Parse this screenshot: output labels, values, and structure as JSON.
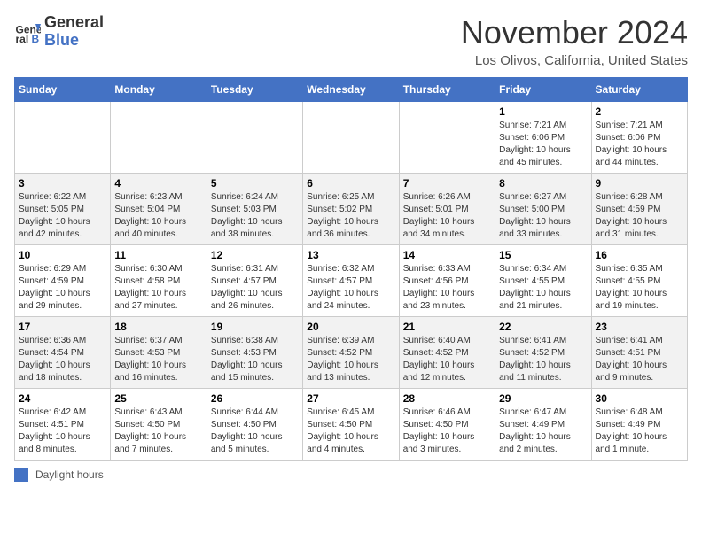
{
  "header": {
    "logo_line1": "General",
    "logo_line2": "Blue",
    "month": "November 2024",
    "location": "Los Olivos, California, United States"
  },
  "days_of_week": [
    "Sunday",
    "Monday",
    "Tuesday",
    "Wednesday",
    "Thursday",
    "Friday",
    "Saturday"
  ],
  "weeks": [
    [
      {
        "day": "",
        "info": ""
      },
      {
        "day": "",
        "info": ""
      },
      {
        "day": "",
        "info": ""
      },
      {
        "day": "",
        "info": ""
      },
      {
        "day": "",
        "info": ""
      },
      {
        "day": "1",
        "info": "Sunrise: 7:21 AM\nSunset: 6:06 PM\nDaylight: 10 hours and 45 minutes."
      },
      {
        "day": "2",
        "info": "Sunrise: 7:21 AM\nSunset: 6:06 PM\nDaylight: 10 hours and 44 minutes."
      }
    ],
    [
      {
        "day": "3",
        "info": "Sunrise: 6:22 AM\nSunset: 5:05 PM\nDaylight: 10 hours and 42 minutes."
      },
      {
        "day": "4",
        "info": "Sunrise: 6:23 AM\nSunset: 5:04 PM\nDaylight: 10 hours and 40 minutes."
      },
      {
        "day": "5",
        "info": "Sunrise: 6:24 AM\nSunset: 5:03 PM\nDaylight: 10 hours and 38 minutes."
      },
      {
        "day": "6",
        "info": "Sunrise: 6:25 AM\nSunset: 5:02 PM\nDaylight: 10 hours and 36 minutes."
      },
      {
        "day": "7",
        "info": "Sunrise: 6:26 AM\nSunset: 5:01 PM\nDaylight: 10 hours and 34 minutes."
      },
      {
        "day": "8",
        "info": "Sunrise: 6:27 AM\nSunset: 5:00 PM\nDaylight: 10 hours and 33 minutes."
      },
      {
        "day": "9",
        "info": "Sunrise: 6:28 AM\nSunset: 4:59 PM\nDaylight: 10 hours and 31 minutes."
      }
    ],
    [
      {
        "day": "10",
        "info": "Sunrise: 6:29 AM\nSunset: 4:59 PM\nDaylight: 10 hours and 29 minutes."
      },
      {
        "day": "11",
        "info": "Sunrise: 6:30 AM\nSunset: 4:58 PM\nDaylight: 10 hours and 27 minutes."
      },
      {
        "day": "12",
        "info": "Sunrise: 6:31 AM\nSunset: 4:57 PM\nDaylight: 10 hours and 26 minutes."
      },
      {
        "day": "13",
        "info": "Sunrise: 6:32 AM\nSunset: 4:57 PM\nDaylight: 10 hours and 24 minutes."
      },
      {
        "day": "14",
        "info": "Sunrise: 6:33 AM\nSunset: 4:56 PM\nDaylight: 10 hours and 23 minutes."
      },
      {
        "day": "15",
        "info": "Sunrise: 6:34 AM\nSunset: 4:55 PM\nDaylight: 10 hours and 21 minutes."
      },
      {
        "day": "16",
        "info": "Sunrise: 6:35 AM\nSunset: 4:55 PM\nDaylight: 10 hours and 19 minutes."
      }
    ],
    [
      {
        "day": "17",
        "info": "Sunrise: 6:36 AM\nSunset: 4:54 PM\nDaylight: 10 hours and 18 minutes."
      },
      {
        "day": "18",
        "info": "Sunrise: 6:37 AM\nSunset: 4:53 PM\nDaylight: 10 hours and 16 minutes."
      },
      {
        "day": "19",
        "info": "Sunrise: 6:38 AM\nSunset: 4:53 PM\nDaylight: 10 hours and 15 minutes."
      },
      {
        "day": "20",
        "info": "Sunrise: 6:39 AM\nSunset: 4:52 PM\nDaylight: 10 hours and 13 minutes."
      },
      {
        "day": "21",
        "info": "Sunrise: 6:40 AM\nSunset: 4:52 PM\nDaylight: 10 hours and 12 minutes."
      },
      {
        "day": "22",
        "info": "Sunrise: 6:41 AM\nSunset: 4:52 PM\nDaylight: 10 hours and 11 minutes."
      },
      {
        "day": "23",
        "info": "Sunrise: 6:41 AM\nSunset: 4:51 PM\nDaylight: 10 hours and 9 minutes."
      }
    ],
    [
      {
        "day": "24",
        "info": "Sunrise: 6:42 AM\nSunset: 4:51 PM\nDaylight: 10 hours and 8 minutes."
      },
      {
        "day": "25",
        "info": "Sunrise: 6:43 AM\nSunset: 4:50 PM\nDaylight: 10 hours and 7 minutes."
      },
      {
        "day": "26",
        "info": "Sunrise: 6:44 AM\nSunset: 4:50 PM\nDaylight: 10 hours and 5 minutes."
      },
      {
        "day": "27",
        "info": "Sunrise: 6:45 AM\nSunset: 4:50 PM\nDaylight: 10 hours and 4 minutes."
      },
      {
        "day": "28",
        "info": "Sunrise: 6:46 AM\nSunset: 4:50 PM\nDaylight: 10 hours and 3 minutes."
      },
      {
        "day": "29",
        "info": "Sunrise: 6:47 AM\nSunset: 4:49 PM\nDaylight: 10 hours and 2 minutes."
      },
      {
        "day": "30",
        "info": "Sunrise: 6:48 AM\nSunset: 4:49 PM\nDaylight: 10 hours and 1 minute."
      }
    ]
  ],
  "legend": {
    "label": "Daylight hours"
  }
}
